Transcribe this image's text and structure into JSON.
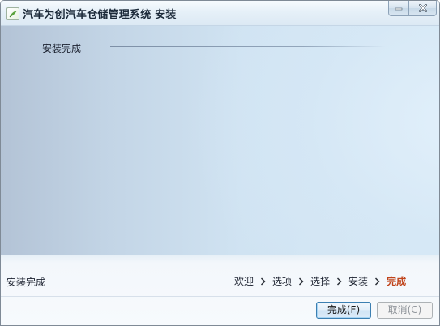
{
  "window": {
    "title": "汽车为创汽车仓储管理系统 安装"
  },
  "content": {
    "heading": "安装完成"
  },
  "footer": {
    "status": "安装完成",
    "steps": [
      {
        "label": "欢迎",
        "current": false
      },
      {
        "label": "选项",
        "current": false
      },
      {
        "label": "选择",
        "current": false
      },
      {
        "label": "安装",
        "current": false
      },
      {
        "label": "完成",
        "current": true
      }
    ],
    "finish_label": "完成(F)",
    "cancel_label": "取消(C)"
  },
  "colors": {
    "current_step": "#c0441b",
    "disabled_text": "#8e9399"
  }
}
